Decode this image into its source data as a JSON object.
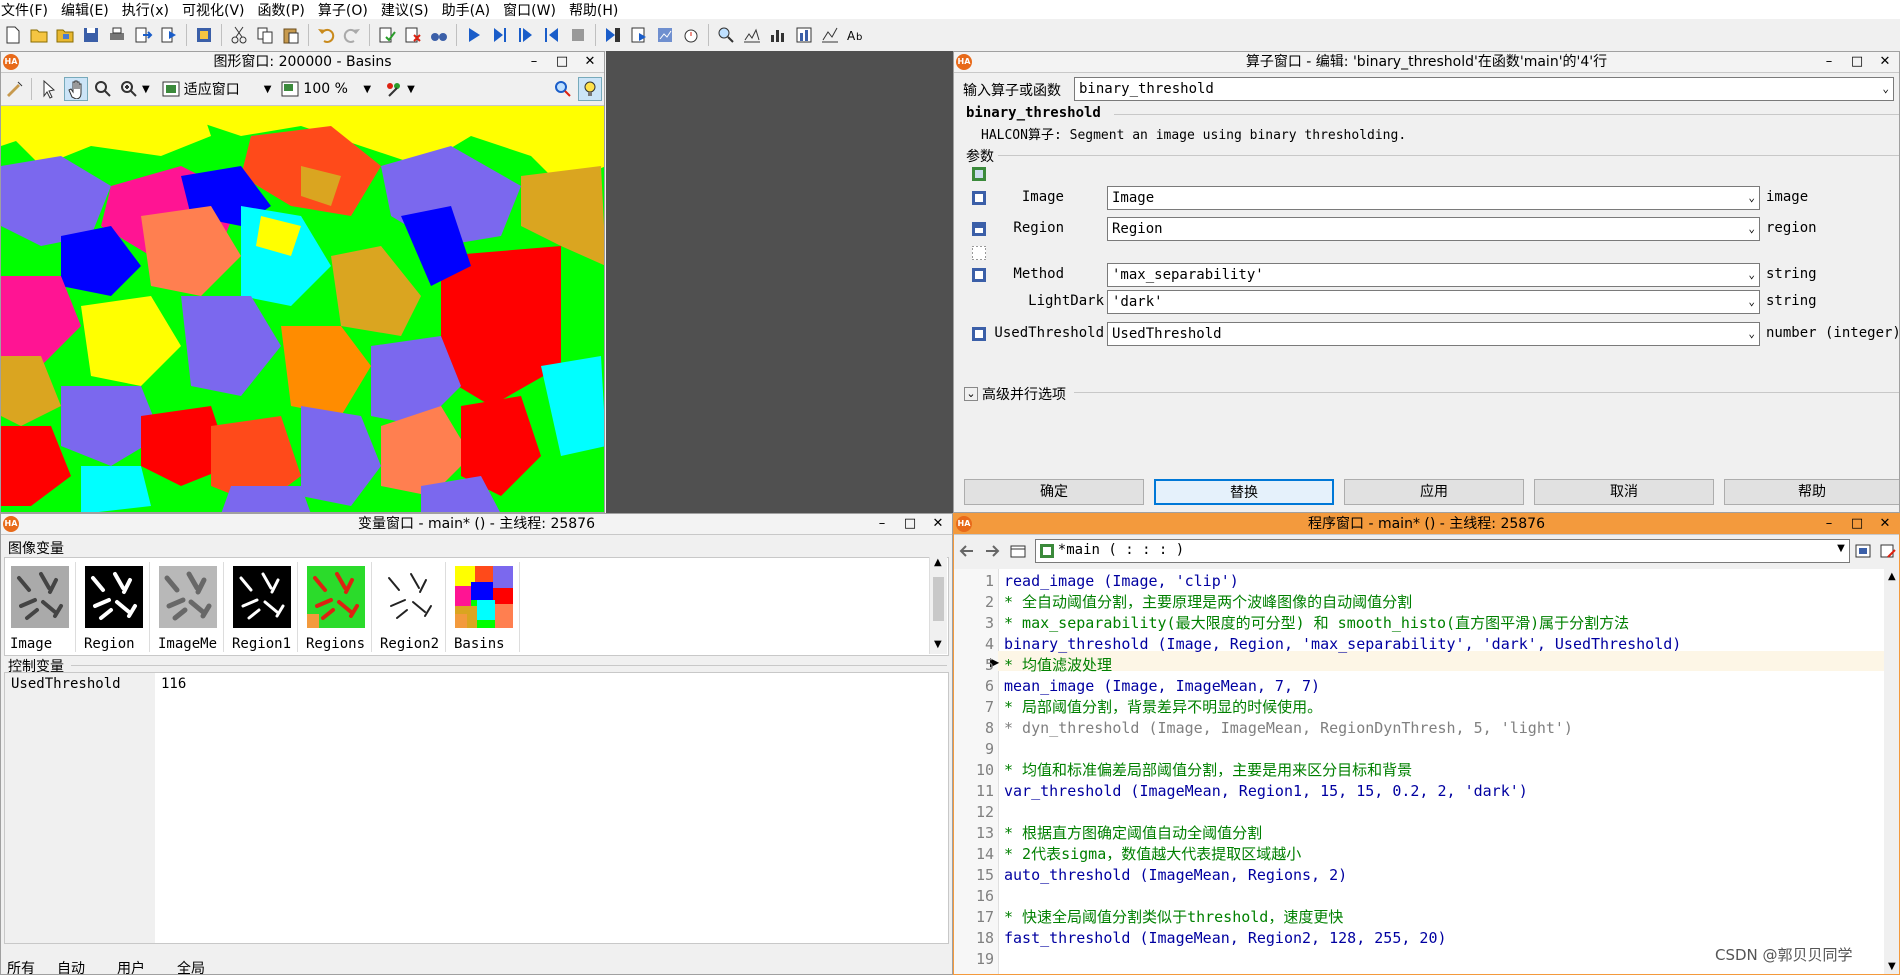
{
  "menu": [
    "文件(F)",
    "编辑(E)",
    "执行(x)",
    "可视化(V)",
    "函数(P)",
    "算子(O)",
    "建议(S)",
    "助手(A)",
    "窗口(W)",
    "帮助(H)"
  ],
  "graphics_window": {
    "title": "图形窗口: 200000 - Basins",
    "fit_label": "适应窗口",
    "zoom": "100 %"
  },
  "operator_window": {
    "title": "算子窗口 - 编辑: 'binary_threshold'在函数'main'的'4'行",
    "input_label": "输入算子或函数",
    "input_value": "binary_threshold",
    "op_name": "binary_threshold",
    "description": "HALCON算子: Segment an image using binary thresholding.",
    "params_label": "参数",
    "params": [
      {
        "label": "Image",
        "value": "Image",
        "type": "image"
      },
      {
        "label": "Region",
        "value": "Region",
        "type": "region"
      },
      {
        "label": "Method",
        "value": "'max_separability'",
        "type": "string"
      },
      {
        "label": "LightDark",
        "value": "'dark'",
        "type": "string"
      },
      {
        "label": "UsedThreshold",
        "value": "UsedThreshold",
        "type": "number (integer)"
      }
    ],
    "advanced_label": "高级并行选项",
    "buttons": [
      "确定",
      "替换",
      "应用",
      "取消",
      "帮助"
    ]
  },
  "variable_window": {
    "title": "变量窗口 - main* () - 主线程: 25876",
    "image_vars_label": "图像变量",
    "image_vars": [
      "Image",
      "Region",
      "ImageMe",
      "Region1",
      "Regions",
      "Region2",
      "Basins"
    ],
    "control_vars_label": "控制变量",
    "control_vars": [
      {
        "name": "UsedThreshold",
        "value": "116"
      }
    ],
    "tabs": [
      "所有",
      "自动",
      "用户",
      "全局"
    ]
  },
  "program_window": {
    "title": "程序窗口 - main* () - 主线程: 25876",
    "proc_select": "*main ( : : : )",
    "lines": [
      {
        "n": "1",
        "text": "read_image (Image, 'clip')",
        "kind": "kw"
      },
      {
        "n": "2",
        "text": "* 全自动阈值分割，主要原理是两个波峰图像的自动阈值分割",
        "kind": "cm"
      },
      {
        "n": "3",
        "text": "* max_separability(最大限度的可分型) 和 smooth_histo(直方图平滑)属于分割方法",
        "kind": "cm"
      },
      {
        "n": "4",
        "text": "binary_threshold (Image, Region, 'max_separability', 'dark', UsedThreshold)",
        "kind": "kw"
      },
      {
        "n": "5",
        "text": "* 均值滤波处理",
        "kind": "cm"
      },
      {
        "n": "6",
        "text": "mean_image (Image, ImageMean, 7, 7)",
        "kind": "kw"
      },
      {
        "n": "7",
        "text": "* 局部阈值分割，背景差异不明显的时候使用。",
        "kind": "cm"
      },
      {
        "n": "8",
        "text": "* dyn_threshold (Image, ImageMean, RegionDynThresh, 5, 'light')",
        "kind": "gr"
      },
      {
        "n": "9",
        "text": "",
        "kind": "kw"
      },
      {
        "n": "10",
        "text": "* 均值和标准偏差局部阈值分割，主要是用来区分目标和背景",
        "kind": "cm"
      },
      {
        "n": "11",
        "text": "var_threshold (ImageMean, Region1, 15, 15, 0.2, 2, 'dark')",
        "kind": "kw"
      },
      {
        "n": "12",
        "text": "",
        "kind": "kw"
      },
      {
        "n": "13",
        "text": "* 根据直方图确定阈值自动全阈值分割",
        "kind": "cm"
      },
      {
        "n": "14",
        "text": "* 2代表sigma，数值越大代表提取区域越小",
        "kind": "cm"
      },
      {
        "n": "15",
        "text": "auto_threshold (ImageMean, Regions, 2)",
        "kind": "kw"
      },
      {
        "n": "16",
        "text": "",
        "kind": "kw"
      },
      {
        "n": "17",
        "text": "* 快速全局阈值分割类似于threshold，速度更快",
        "kind": "cm"
      },
      {
        "n": "18",
        "text": "fast_threshold (ImageMean, Region2, 128, 255, 20)",
        "kind": "kw"
      },
      {
        "n": "19",
        "text": "",
        "kind": "kw"
      }
    ]
  },
  "watermark": "CSDN @郭贝贝同学"
}
